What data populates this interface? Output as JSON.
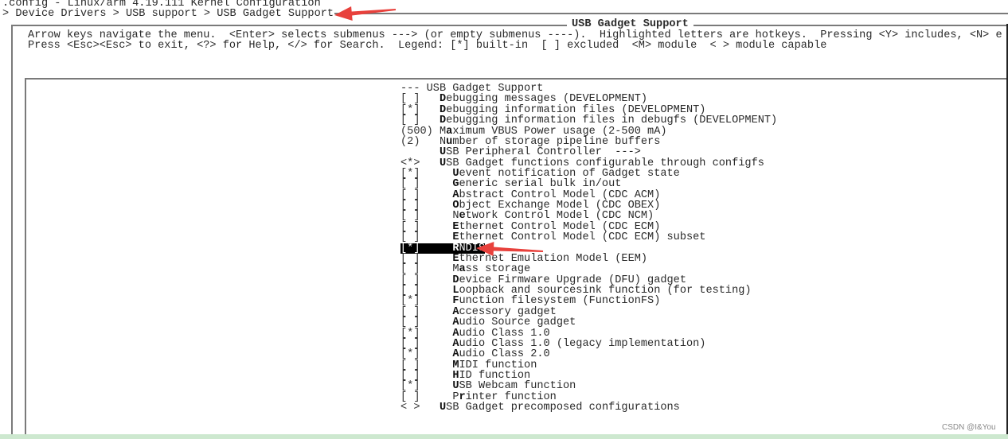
{
  "window_title": ".config - Linux/arm 4.19.111 Kernel Configuration",
  "breadcrumb": "> Device Drivers > USB support > USB Gadget Support",
  "dialog": {
    "title": "USB Gadget Support",
    "help_line_1": "Arrow keys navigate the menu.  <Enter> selects submenus ---> (or empty submenus ----).  Highlighted letters are hotkeys.  Pressing <Y> includes, <N> e",
    "help_line_2": "Press <Esc><Esc> to exit, <?> for Help, </> for Search.  Legend: [*] built-in  [ ] excluded  <M> module  < > module capable"
  },
  "menu": {
    "header": "--- USB Gadget Support",
    "items": [
      {
        "prefix": "[ ]",
        "depth": 0,
        "text": "Debugging messages (DEVELOPMENT)",
        "hotkey": 0
      },
      {
        "prefix": "[*]",
        "depth": 0,
        "text": "Debugging information files (DEVELOPMENT)",
        "hotkey": 0
      },
      {
        "prefix": "[ ]",
        "depth": 0,
        "text": "Debugging information files in debugfs (DEVELOPMENT)",
        "hotkey": 0
      },
      {
        "prefix": "(500)",
        "depth": 0,
        "text": "Maximum VBUS Power usage (2-500 mA)",
        "hotkey": 1
      },
      {
        "prefix": "(2)",
        "depth": 0,
        "text": "Number of storage pipeline buffers",
        "hotkey": 1
      },
      {
        "prefix": "",
        "depth": 0,
        "text": "USB Peripheral Controller  --->",
        "hotkey": 0
      },
      {
        "prefix": "<*>",
        "depth": 0,
        "text": "USB Gadget functions configurable through configfs",
        "hotkey": 0
      },
      {
        "prefix": "[*]",
        "depth": 1,
        "text": "Uevent notification of Gadget state",
        "hotkey": 0
      },
      {
        "prefix": "[ ]",
        "depth": 1,
        "text": "Generic serial bulk in/out",
        "hotkey": 0
      },
      {
        "prefix": "[ ]",
        "depth": 1,
        "text": "Abstract Control Model (CDC ACM)",
        "hotkey": 0
      },
      {
        "prefix": "[ ]",
        "depth": 1,
        "text": "Object Exchange Model (CDC OBEX)",
        "hotkey": 0
      },
      {
        "prefix": "[ ]",
        "depth": 1,
        "text": "Network Control Model (CDC NCM)",
        "hotkey": 1
      },
      {
        "prefix": "[ ]",
        "depth": 1,
        "text": "Ethernet Control Model (CDC ECM)",
        "hotkey": 0
      },
      {
        "prefix": "[ ]",
        "depth": 1,
        "text": "Ethernet Control Model (CDC ECM) subset",
        "hotkey": 0
      },
      {
        "prefix": "[*]",
        "depth": 1,
        "text": "RNDIS",
        "hotkey": 0,
        "selected": true
      },
      {
        "prefix": "[ ]",
        "depth": 1,
        "text": "Ethernet Emulation Model (EEM)",
        "hotkey": 0
      },
      {
        "prefix": "[ ]",
        "depth": 1,
        "text": "Mass storage",
        "hotkey": 1
      },
      {
        "prefix": "[ ]",
        "depth": 1,
        "text": "Device Firmware Upgrade (DFU) gadget",
        "hotkey": 0
      },
      {
        "prefix": "[ ]",
        "depth": 1,
        "text": "Loopback and sourcesink function (for testing)",
        "hotkey": 0
      },
      {
        "prefix": "[*]",
        "depth": 1,
        "text": "Function filesystem (FunctionFS)",
        "hotkey": 0
      },
      {
        "prefix": "[ ]",
        "depth": 1,
        "text": "Accessory gadget",
        "hotkey": 0
      },
      {
        "prefix": "[ ]",
        "depth": 1,
        "text": "Audio Source gadget",
        "hotkey": 0
      },
      {
        "prefix": "[*]",
        "depth": 1,
        "text": "Audio Class 1.0",
        "hotkey": 0
      },
      {
        "prefix": "[ ]",
        "depth": 1,
        "text": "Audio Class 1.0 (legacy implementation)",
        "hotkey": 0
      },
      {
        "prefix": "[*]",
        "depth": 1,
        "text": "Audio Class 2.0",
        "hotkey": 0
      },
      {
        "prefix": "[ ]",
        "depth": 1,
        "text": "MIDI function",
        "hotkey": 0
      },
      {
        "prefix": "[ ]",
        "depth": 1,
        "text": "HID function",
        "hotkey": 0
      },
      {
        "prefix": "[*]",
        "depth": 1,
        "text": "USB Webcam function",
        "hotkey": 0
      },
      {
        "prefix": "[ ]",
        "depth": 1,
        "text": "Printer function",
        "hotkey": 1
      },
      {
        "prefix": "< >",
        "depth": 0,
        "text": "USB Gadget precomposed configurations",
        "hotkey": 0
      }
    ]
  },
  "annotations": {
    "arrow_color": "#e8413c"
  },
  "watermark": "CSDN @I&You"
}
